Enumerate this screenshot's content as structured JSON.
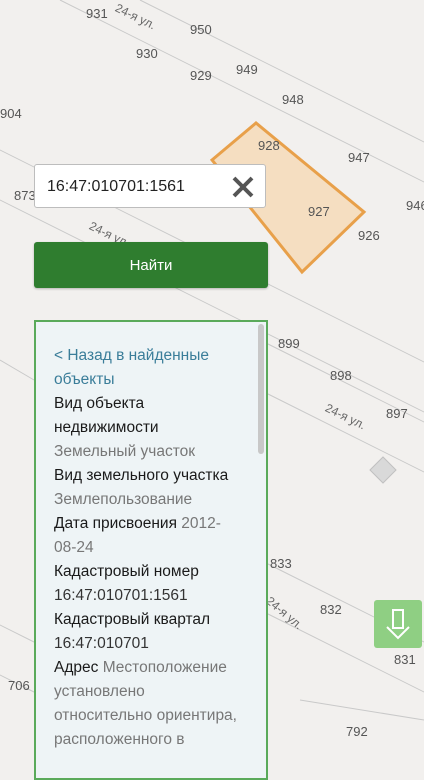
{
  "map": {
    "parcel_numbers": [
      "931",
      "950",
      "930",
      "949",
      "929",
      "948",
      "904",
      "928",
      "947",
      "873",
      "927",
      "946",
      "926",
      "899",
      "898",
      "897",
      "833",
      "832",
      "831",
      "706",
      "792"
    ],
    "street_labels": [
      "24-я ул.",
      "24-я ул.",
      "24-я ул.",
      "24-я ул."
    ],
    "colors": {
      "parcel_fill": "#f5d9b5",
      "parcel_stroke": "#e8a04a",
      "accent_green": "#2f7d2f"
    }
  },
  "search": {
    "value": "16:47:010701:1561",
    "clear_icon": "close-icon"
  },
  "find_button": {
    "label": "Найти"
  },
  "panel": {
    "back_link": "< Назад в найденные объекты",
    "fields": [
      {
        "label": "Вид объекта недвижимости",
        "value": "Земельный участок"
      },
      {
        "label": "Вид земельного участка",
        "value": "Землепользование"
      },
      {
        "label": "Дата присвоения",
        "value": "2012-08-24"
      },
      {
        "label": "Кадастровый номер",
        "value": "16:47:010701:1561"
      },
      {
        "label": "Кадастровый квартал",
        "value": "16:47:010701"
      },
      {
        "label": "Адрес",
        "value": "Местоположение установлено относительно ориентира, расположенного в"
      }
    ]
  },
  "down_button": {
    "icon": "arrow-down-icon"
  }
}
